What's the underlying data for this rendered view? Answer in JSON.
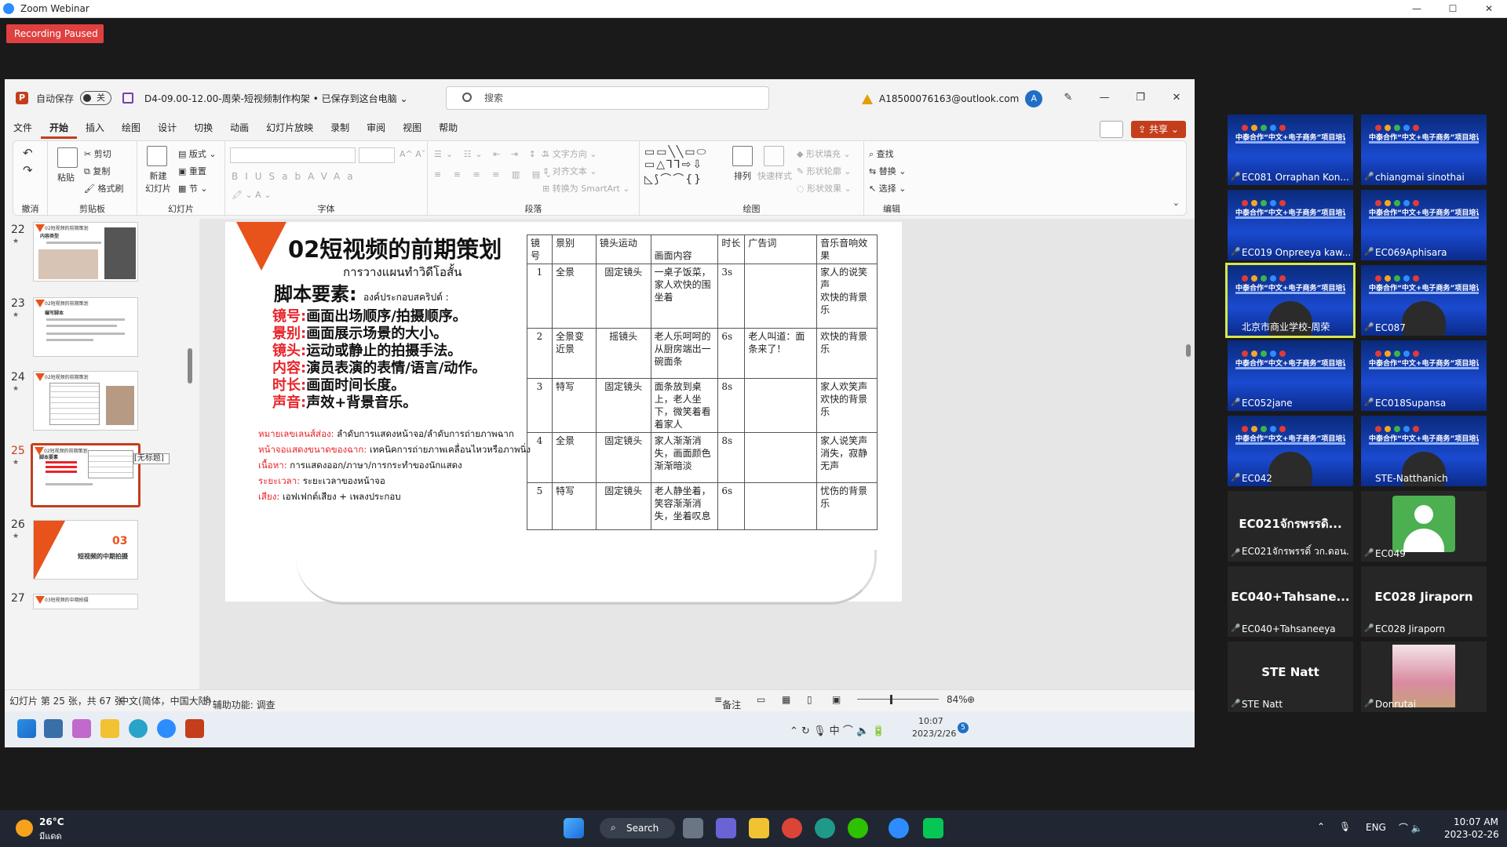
{
  "zoom": {
    "window_title": "Zoom Webinar",
    "recording_badge": "Recording Paused"
  },
  "ppt": {
    "autosave_label": "自动保存",
    "autosave_state": "关",
    "doc_title": "D4-09.00-12.00-周荣-短视频制作构架 • 已保存到这台电脑 ⌄",
    "search_placeholder": "搜索",
    "account_email": "A18500076163@outlook.com",
    "account_initial": "A",
    "menu": [
      "文件",
      "开始",
      "插入",
      "绘图",
      "设计",
      "切换",
      "动画",
      "幻灯片放映",
      "录制",
      "审阅",
      "视图",
      "帮助"
    ],
    "active_menu": "开始",
    "share_label": "共享",
    "ribbon": {
      "undo": "撤消",
      "clipboard": {
        "label": "剪贴板",
        "paste": "粘贴",
        "cut": "剪切",
        "copy": "复制",
        "format_painter": "格式刷"
      },
      "slides": {
        "label": "幻灯片",
        "new_slide": "新建\n幻灯片",
        "layout": "版式",
        "reset": "重置",
        "section": "节"
      },
      "font_label": "字体",
      "paragraph": {
        "label": "段落",
        "text_direction": "文字方向",
        "align_text": "对齐文本",
        "smartart": "转换为 SmartArt"
      },
      "drawing": {
        "label": "绘图",
        "arrange": "排列",
        "quick_styles": "快速样式",
        "fill": "形状填充",
        "outline": "形状轮廓",
        "effects": "形状效果"
      },
      "editing": {
        "label": "编辑",
        "find": "查找",
        "replace": "替换",
        "select": "选择"
      }
    },
    "thumbs": [
      {
        "num": "22",
        "title": "02短视频的前期策划",
        "heading": "内容类型"
      },
      {
        "num": "23",
        "title": "02短视频的前期策划",
        "heading": "编写脚本"
      },
      {
        "num": "24",
        "title": "02短视频的前期策划",
        "heading": ""
      },
      {
        "num": "25",
        "title": "02短视频的前期策划",
        "heading": "脚本要素"
      },
      {
        "num": "26",
        "title": "03",
        "heading": "短视频的中期拍摄"
      },
      {
        "num": "27",
        "title": "03短视频的中期拍摄",
        "heading": ""
      }
    ],
    "thumb_tooltip": "[无标题]",
    "slide": {
      "title": "02短视频的前期策划",
      "subtitle": "การวางแผนทำวิดีโอสั้น",
      "heading": "脚本要素:",
      "heading_thai": "องค์ประกอบสคริปต์ :",
      "rows": [
        {
          "k": "镜号:",
          "v": "画面出场顺序/拍摄顺序。"
        },
        {
          "k": "景别:",
          "v": "画面展示场景的大小。"
        },
        {
          "k": "镜头:",
          "v": "运动或静止的拍摄手法。"
        },
        {
          "k": "内容:",
          "v": "演员表演的表情/语言/动作。"
        },
        {
          "k": "时长:",
          "v": "画面时间长度。"
        },
        {
          "k": "声音:",
          "v": "声效+背景音乐。"
        }
      ],
      "thai_rows": [
        {
          "k": "หมายเลขเลนส์ส่อง:",
          "v": " ลำดับการแสดงหน้าจอ/ลำดับการถ่ายภาพฉาก"
        },
        {
          "k": "หน้าจอแสดงขนาดของฉาก:",
          "v": " เทคนิคการถ่ายภาพเคลื่อนไหวหรือภาพนิ่ง"
        },
        {
          "k": "เนื้อหา:",
          "v": " การแสดงออก/ภาษา/การกระทำของนักแสดง"
        },
        {
          "k": "ระยะเวลา:",
          "v": " ระยะเวลาของหน้าจอ"
        },
        {
          "k": "เสียง:",
          "v": " เอฟเฟกต์เสียง + เพลงประกอบ"
        }
      ],
      "table": {
        "headers": [
          "镜号",
          "景别",
          "镜头运动",
          "画面内容",
          "时长",
          "广告词",
          "音乐音响效果"
        ],
        "rows": [
          [
            "1",
            "全景",
            "固定镜头",
            "一桌子饭菜，家人欢快的围坐着",
            "3s",
            "",
            "家人的说笑声\n欢快的背景乐"
          ],
          [
            "2",
            "全景变近景",
            "摇镜头",
            "老人乐呵呵的从厨房端出一碗面条",
            "6s",
            "老人叫道：面条来了！",
            "欢快的背景乐"
          ],
          [
            "3",
            "特写",
            "固定镜头",
            "面条放到桌上，老人坐下，微笑着看着家人",
            "8s",
            "",
            "家人欢笑声\n欢快的背景乐"
          ],
          [
            "4",
            "全景",
            "固定镜头",
            "家人渐渐消失，画面颜色渐渐暗淡",
            "8s",
            "",
            "家人说笑声消失，寂静无声"
          ],
          [
            "5",
            "特写",
            "固定镜头",
            "老人静坐着，笑容渐渐消失，坐着叹息",
            "6s",
            "",
            "忧伤的背景乐"
          ]
        ]
      }
    },
    "status": {
      "slide_pos": "幻灯片 第 25 张，共 67 张",
      "language": "中文(简体，中国大陆)",
      "accessibility": "辅助功能: 调查",
      "notes": "备注",
      "zoom": "84%"
    },
    "remote_clock": {
      "time": "10:07",
      "date": "2023/2/26",
      "badge": "5"
    }
  },
  "gallery": [
    {
      "name": "EC081 Orraphan Kon...",
      "kind": "banner",
      "muted": true
    },
    {
      "name": "chiangmai sinothai",
      "kind": "banner",
      "muted": true
    },
    {
      "name": "EC019 Onpreeya kaw...",
      "kind": "banner",
      "muted": true
    },
    {
      "name": "EC069Aphisara",
      "kind": "banner",
      "muted": true
    },
    {
      "name": "北京市商业学校-周荣",
      "kind": "banner-person",
      "muted": false,
      "speaking": true
    },
    {
      "name": "EC087",
      "kind": "banner-person",
      "muted": true
    },
    {
      "name": "EC052jane",
      "kind": "banner",
      "muted": true
    },
    {
      "name": "EC018Supansa",
      "kind": "banner",
      "muted": true
    },
    {
      "name": "EC042",
      "kind": "banner-person",
      "muted": true
    },
    {
      "name": "STE-Natthanich",
      "kind": "banner-person",
      "muted": false
    },
    {
      "name": "EC021จักรพรรดิ์ วก.ดอน...",
      "kind": "text",
      "big": "EC021จักรพรรดิ...",
      "muted": true
    },
    {
      "name": "EC049",
      "kind": "avatar",
      "muted": true
    },
    {
      "name": "EC040+Tahsaneeya",
      "kind": "text",
      "big": "EC040+Tahsane...",
      "muted": true
    },
    {
      "name": "EC028 Jiraporn",
      "kind": "text",
      "big": "EC028 Jiraporn",
      "muted": true
    },
    {
      "name": "STE Natt",
      "kind": "text",
      "big": "STE Natt",
      "muted": true
    },
    {
      "name": "Donrutai",
      "kind": "photo",
      "muted": true
    }
  ],
  "banner_title": "中泰合作“中文+电子商务”项目培训活动",
  "host": {
    "weather_temp": "26°C",
    "weather_desc": "มีแดด",
    "search_label": "Search",
    "lang": "ENG",
    "time": "10:07 AM",
    "date": "2023-02-26"
  },
  "colors": {
    "accent_red": "#c43e1c",
    "slide_orange": "#e8521b",
    "slide_red_text": "#e8242a",
    "speaker_outline": "#d7e84a"
  }
}
